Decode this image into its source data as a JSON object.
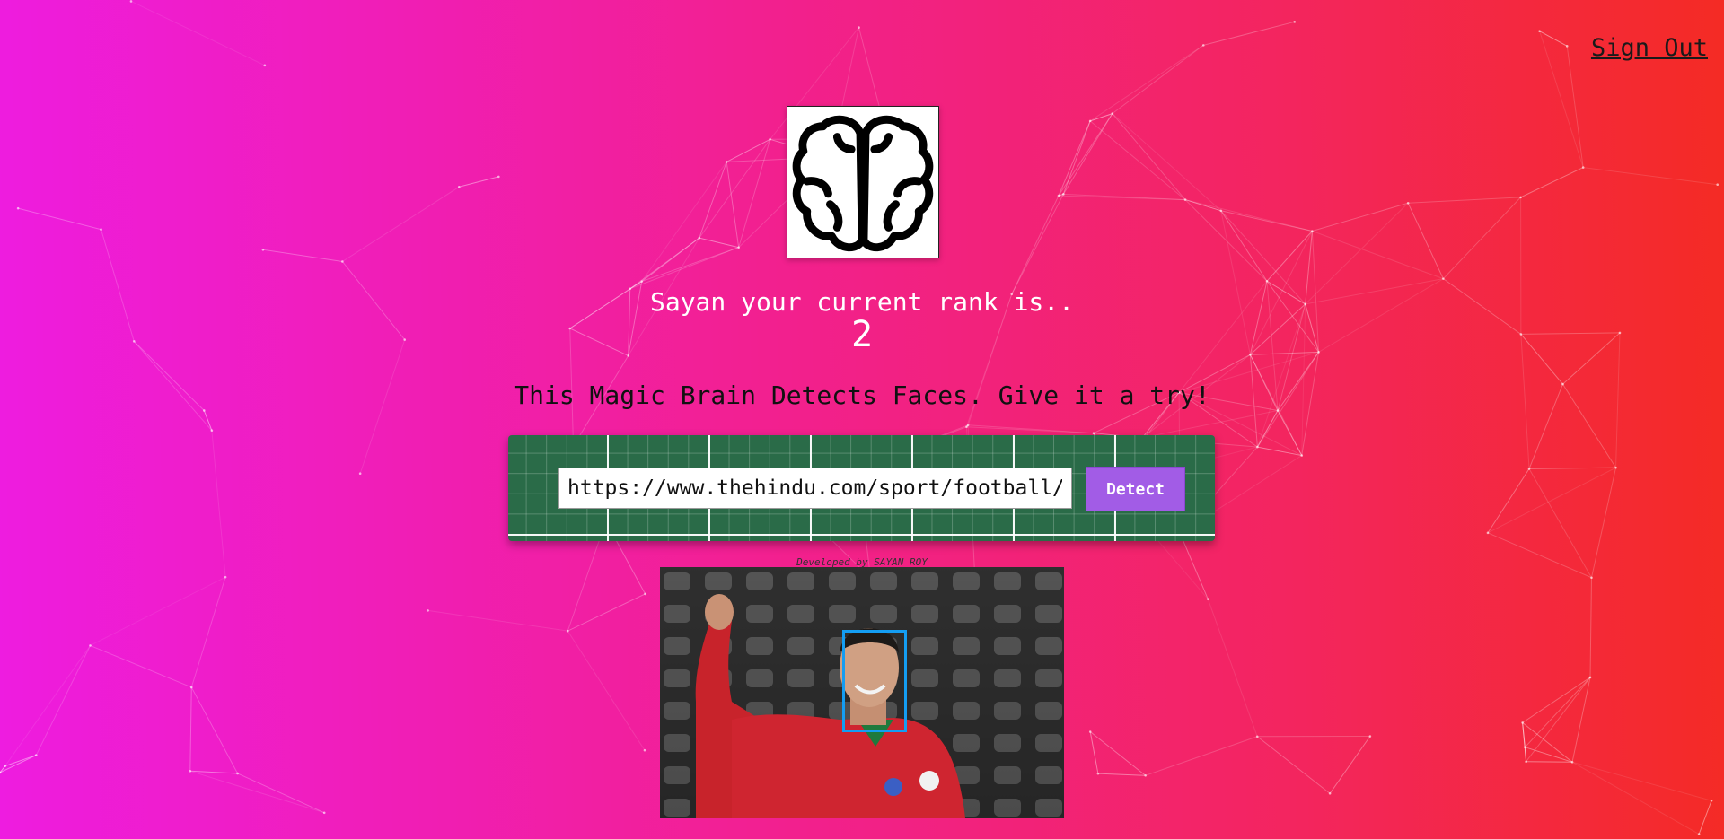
{
  "header": {
    "sign_out_label": "Sign Out"
  },
  "logo": {
    "icon": "brain-icon"
  },
  "rank": {
    "message": "Sayan your current rank is..",
    "value": "2"
  },
  "tagline": "This Magic Brain Detects Faces. Give it a try!",
  "form": {
    "url_value": "https://www.thehindu.com/sport/football/portugal-ronaldo.jpg",
    "detect_label": "Detect"
  },
  "footer": {
    "credit": "Developed by SAYAN ROY"
  },
  "colors": {
    "gradient_start": "#ee1ce0",
    "gradient_end": "#f42b24",
    "form_panel": "#2a6b48",
    "detect_button": "#a25ce6",
    "face_box": "#149df2"
  }
}
